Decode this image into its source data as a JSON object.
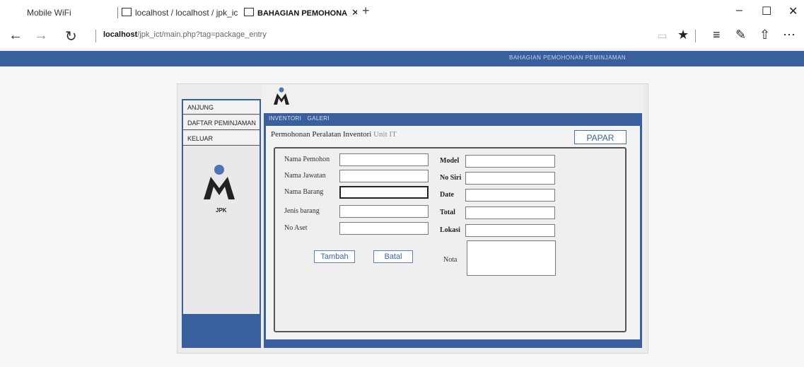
{
  "browser": {
    "tabs": [
      {
        "label": "Mobile WiFi"
      },
      {
        "label": "localhost / localhost / jpk_ic"
      },
      {
        "label": "BAHAGIAN PEMOHONA",
        "close": "✕"
      }
    ],
    "new_tab": "+",
    "window_controls": {
      "minimize": "–",
      "maximize": "☐",
      "close": "✕"
    },
    "url_host": "localhost",
    "url_rest": "/jpk_ict/main.php?tag=package_entry",
    "icons": [
      "back-icon",
      "forward-icon",
      "refresh-icon",
      "reading-view-icon",
      "favorite-star-icon",
      "hub-icon",
      "web-note-icon",
      "share-icon",
      "more-icon"
    ]
  },
  "banner": {
    "text": "BAHAGIAN PEMOHONAN PEMINJAMAN"
  },
  "sidebar": {
    "items": [
      {
        "label": "ANJUNG"
      },
      {
        "label": "DAFTAR PEMINJAMAN"
      },
      {
        "label": "KELUAR"
      }
    ],
    "logo_text": "JPK"
  },
  "main": {
    "tabs": [
      {
        "label": "INVENTORI"
      },
      {
        "label": "GALERI"
      }
    ],
    "section_title": "Permohonan Peralatan Inventori",
    "section_unit": "Unit IT",
    "papar_label": "PAPAR"
  },
  "form": {
    "nama_pemohon": {
      "label": "Nama Pemohon",
      "value": ""
    },
    "nama_jawatan": {
      "label": "Nama Jawatan",
      "value": ""
    },
    "nama_barang": {
      "label": "Nama Barang",
      "value": ""
    },
    "jenis_barang": {
      "label": "Jenis barang",
      "value": ""
    },
    "no_aset": {
      "label": "No Aset",
      "value": ""
    },
    "model": {
      "label": "Model",
      "value": ""
    },
    "no_siri": {
      "label": "No Siri",
      "value": ""
    },
    "date": {
      "label": "Date",
      "value": ""
    },
    "total": {
      "label": "Total",
      "value": ""
    },
    "lokasi": {
      "label": "Lokasi",
      "value": ""
    },
    "nota": {
      "label": "Nota",
      "value": ""
    },
    "tambah_label": "Tambah",
    "batal_label": "Batal"
  },
  "colors": {
    "accent": "#3a5f9e",
    "button_text": "#3b63b0"
  }
}
